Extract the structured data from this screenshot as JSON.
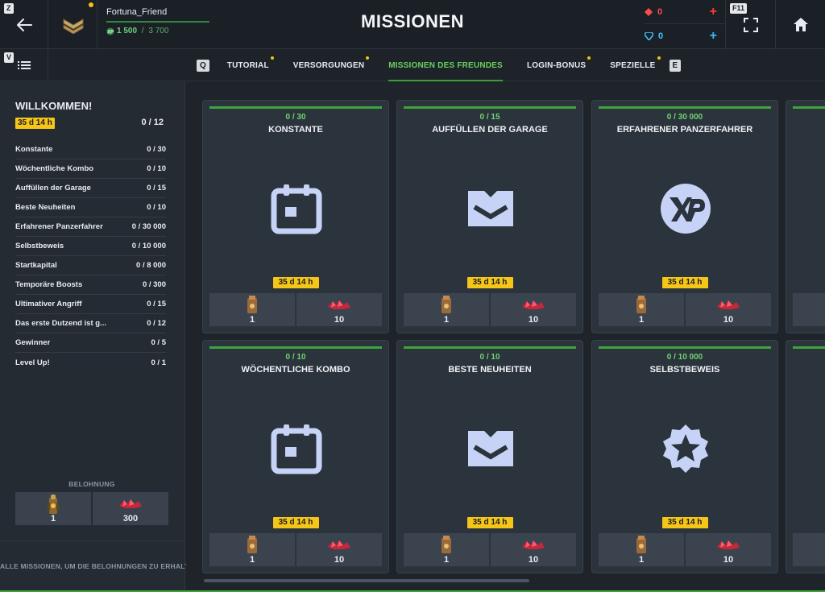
{
  "header": {
    "back_key": "Z",
    "menu_key": "V",
    "fullscreen_key": "F11",
    "title": "MISSIONEN",
    "player": {
      "name": "Fortuna_Friend",
      "xp_current": "1 500",
      "xp_sep": " / ",
      "xp_max": "3 700"
    },
    "currency_red": "0",
    "currency_blue": "0",
    "accent_green": "#3fa53b",
    "timer_yellow": "#f5c518"
  },
  "tabs": {
    "prev_key": "Q",
    "next_key": "E",
    "items": [
      {
        "label": "TUTORIAL"
      },
      {
        "label": "VERSORGUNGEN"
      },
      {
        "label": "MISSIONEN DES FREUNDES"
      },
      {
        "label": "LOGIN-BONUS"
      },
      {
        "label": "SPEZIELLE"
      }
    ]
  },
  "sidebar": {
    "title": "WILLKOMMEN!",
    "timer": "35 d 14 h",
    "total": "0 / 12",
    "missions": [
      {
        "label": "Konstante",
        "progress": "0 / 30"
      },
      {
        "label": "Wöchentliche Kombo",
        "progress": "0 / 10"
      },
      {
        "label": "Auffüllen der Garage",
        "progress": "0 / 15"
      },
      {
        "label": "Beste Neuheiten",
        "progress": "0 / 10"
      },
      {
        "label": "Erfahrener Panzerfahrer",
        "progress": "0 / 30 000"
      },
      {
        "label": "Selbstbeweis",
        "progress": "0 / 10 000"
      },
      {
        "label": "Startkapital",
        "progress": "0 / 8 000"
      },
      {
        "label": "Temporäre Boosts",
        "progress": "0 / 300"
      },
      {
        "label": "Ultimativer Angriff",
        "progress": "0 / 15"
      },
      {
        "label": "Das erste Dutzend ist g...",
        "progress": "0 / 12"
      },
      {
        "label": "Gewinner",
        "progress": "0 / 5"
      },
      {
        "label": "Level Up!",
        "progress": "0 / 1"
      }
    ],
    "reward_title": "BELOHNUNG",
    "rewards": [
      {
        "qty": "1"
      },
      {
        "qty": "300"
      }
    ],
    "footer": "ALLE MISSIONEN, UM DIE BELOHNUNGEN ZU ERHALTEN"
  },
  "cards": [
    {
      "progress": "0 / 30",
      "title": "KONSTANTE",
      "icon": "calendar-icon",
      "timer": "35 d 14 h",
      "rewards": [
        {
          "qty": "1"
        },
        {
          "qty": "10"
        }
      ]
    },
    {
      "progress": "0 / 15",
      "title": "AUFFÜLLEN DER GARAGE",
      "icon": "garage-icon",
      "timer": "35 d 14 h",
      "rewards": [
        {
          "qty": "1"
        },
        {
          "qty": "10"
        }
      ]
    },
    {
      "progress": "0 / 30 000",
      "title": "ERFAHRENER PANZERFAHRER",
      "icon": "xp-icon",
      "timer": "35 d 14 h",
      "rewards": [
        {
          "qty": "1"
        },
        {
          "qty": "10"
        }
      ]
    },
    {
      "progress": "0 / 10",
      "title": "WÖCHENTLICHE KOMBO",
      "icon": "calendar-icon",
      "timer": "35 d 14 h",
      "rewards": [
        {
          "qty": "1"
        },
        {
          "qty": "10"
        }
      ]
    },
    {
      "progress": "0 / 10",
      "title": "BESTE NEUHEITEN",
      "icon": "garage-icon",
      "timer": "35 d 14 h",
      "rewards": [
        {
          "qty": "1"
        },
        {
          "qty": "10"
        }
      ]
    },
    {
      "progress": "0 / 10 000",
      "title": "SELBSTBEWEIS",
      "icon": "star-badge-icon",
      "timer": "35 d 14 h",
      "rewards": [
        {
          "qty": "1"
        },
        {
          "qty": "10"
        }
      ]
    }
  ]
}
